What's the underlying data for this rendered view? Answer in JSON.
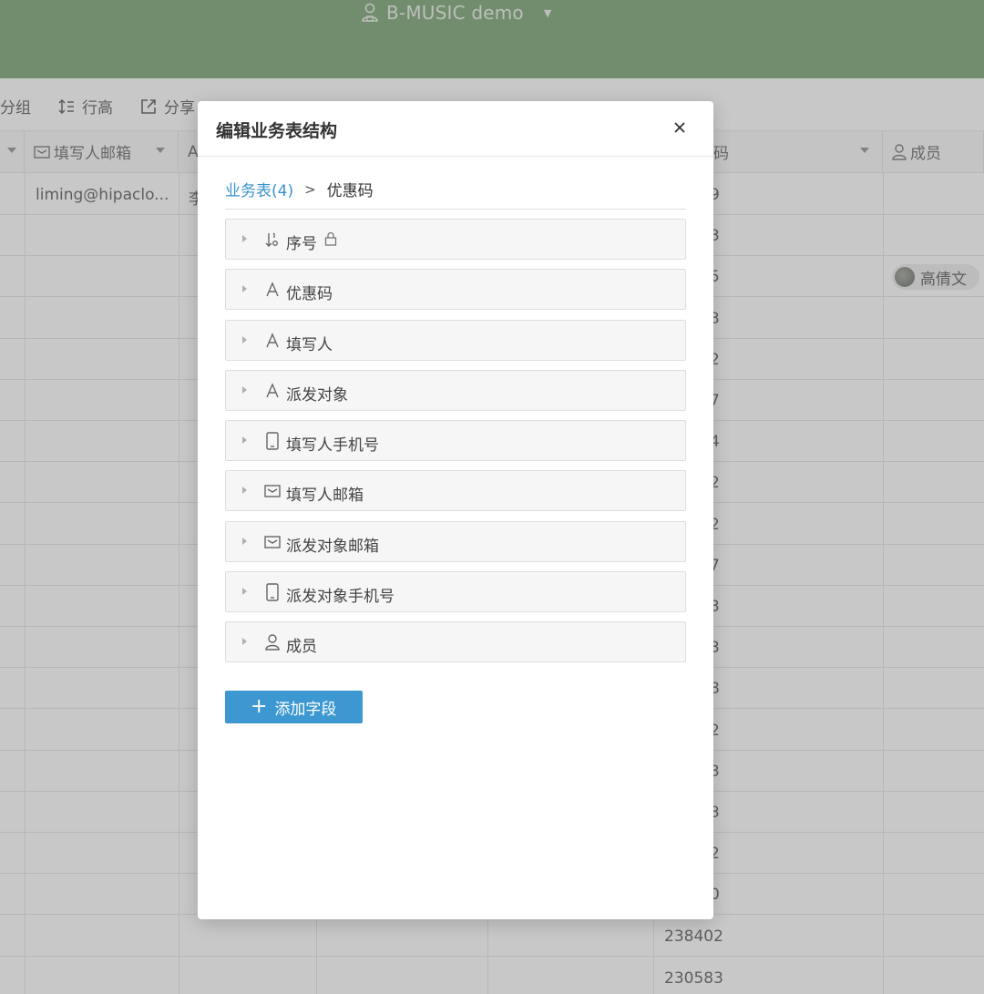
{
  "header": {
    "workspace_title": "B-MUSIC demo"
  },
  "toolbar": {
    "group_label": "分组",
    "row_height_label": "行高",
    "share_label": "分享"
  },
  "grid": {
    "columns": [
      {
        "label": ""
      },
      {
        "label": "填写人邮箱"
      },
      {
        "label": "A"
      },
      {
        "label": "码"
      },
      {
        "label": "成员"
      }
    ],
    "email_cell": "liming@hipaclo...",
    "name_cell": "李",
    "code_partials": [
      "9",
      "3",
      "5",
      "3",
      "2",
      "7",
      "4",
      "2",
      "2",
      "7",
      "3",
      "3",
      "8",
      "2",
      "3",
      "3",
      "2",
      "0"
    ],
    "code_full": [
      "238402",
      "230583"
    ],
    "member_chip": "高倩文"
  },
  "modal": {
    "title": "编辑业务表结构",
    "breadcrumb_parent": "业务表(4)",
    "breadcrumb_current": "优惠码",
    "fields": [
      {
        "label": "序号",
        "icon": "sort-number-icon",
        "locked": true
      },
      {
        "label": "优惠码",
        "icon": "text-icon"
      },
      {
        "label": "填写人",
        "icon": "text-icon"
      },
      {
        "label": "派发对象",
        "icon": "text-icon"
      },
      {
        "label": "填写人手机号",
        "icon": "phone-icon"
      },
      {
        "label": "填写人邮箱",
        "icon": "email-icon"
      },
      {
        "label": "派发对象邮箱",
        "icon": "email-icon"
      },
      {
        "label": "派发对象手机号",
        "icon": "phone-icon"
      },
      {
        "label": "成员",
        "icon": "member-icon"
      }
    ],
    "add_field_label": "添加字段"
  },
  "colors": {
    "header_green": "#5a8f52",
    "accent_blue": "#3d98d2",
    "link_blue": "#3a93cc"
  }
}
